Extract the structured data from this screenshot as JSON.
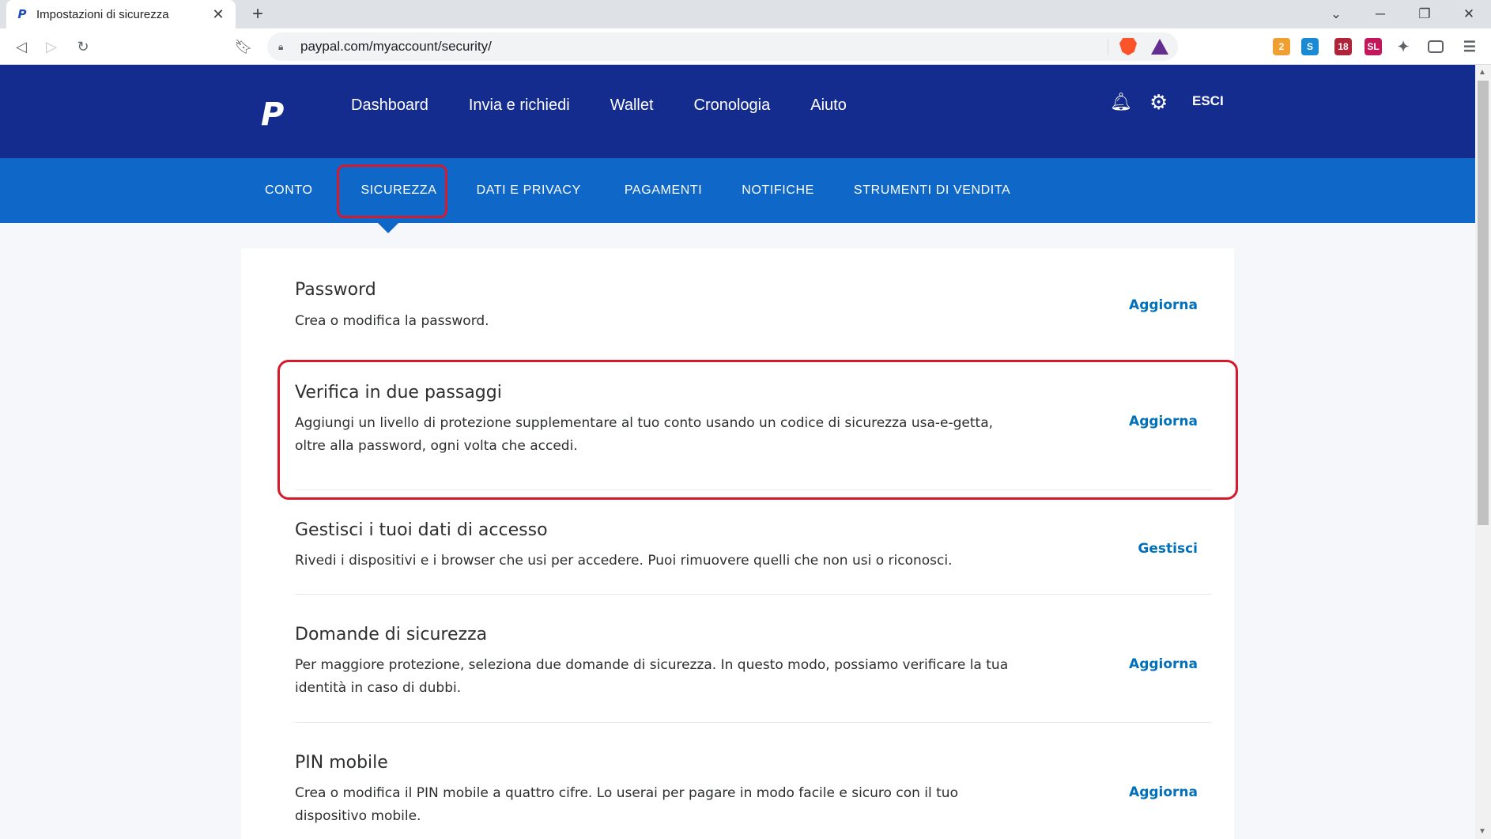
{
  "browser": {
    "tab_title": "Impostazioni di sicurezza",
    "tab_favicon": "P",
    "new_tab": "+",
    "url": "paypal.com/myaccount/security/",
    "back_icon": "back-arrow",
    "forward_icon": "forward-arrow",
    "reload_icon": "reload",
    "ext_badges": {
      "ext1": "2",
      "ext3": "18",
      "ext4": "SL"
    }
  },
  "paypal": {
    "logo": "P",
    "main_nav": [
      "Dashboard",
      "Invia e richiedi",
      "Wallet",
      "Cronologia",
      "Aiuto"
    ],
    "logout": "ESCI",
    "sub_nav": [
      "CONTO",
      "SICUREZZA",
      "DATI E PRIVACY",
      "PAGAMENTI",
      "NOTIFICHE",
      "STRUMENTI DI VENDITA"
    ],
    "active_sub_nav": "SICUREZZA"
  },
  "sections": [
    {
      "title": "Password",
      "desc": "Crea o modifica la password.",
      "action": "Aggiorna"
    },
    {
      "title": "Verifica in due passaggi",
      "desc": "Aggiungi un livello di protezione supplementare al tuo conto usando un codice di sicurezza usa-e-getta, oltre alla password, ogni volta che accedi.",
      "action": "Aggiorna"
    },
    {
      "title": "Gestisci i tuoi dati di accesso",
      "desc": "Rivedi i dispositivi e i browser che usi per accedere. Puoi rimuovere quelli che non usi o riconosci.",
      "action": "Gestisci"
    },
    {
      "title": "Domande di sicurezza",
      "desc": "Per maggiore protezione, seleziona due domande di sicurezza. In questo modo, possiamo verificare la tua identità in caso di dubbi.",
      "action": "Aggiorna"
    },
    {
      "title": "PIN mobile",
      "desc": "Crea o modifica il PIN mobile a quattro cifre. Lo userai per pagare in modo facile e sicuro con il tuo dispositivo mobile.",
      "action": "Aggiorna"
    }
  ],
  "colors": {
    "header": "#142c8e",
    "subnav": "#0f67c8",
    "link": "#0070ba",
    "highlight": "#d6192b"
  }
}
